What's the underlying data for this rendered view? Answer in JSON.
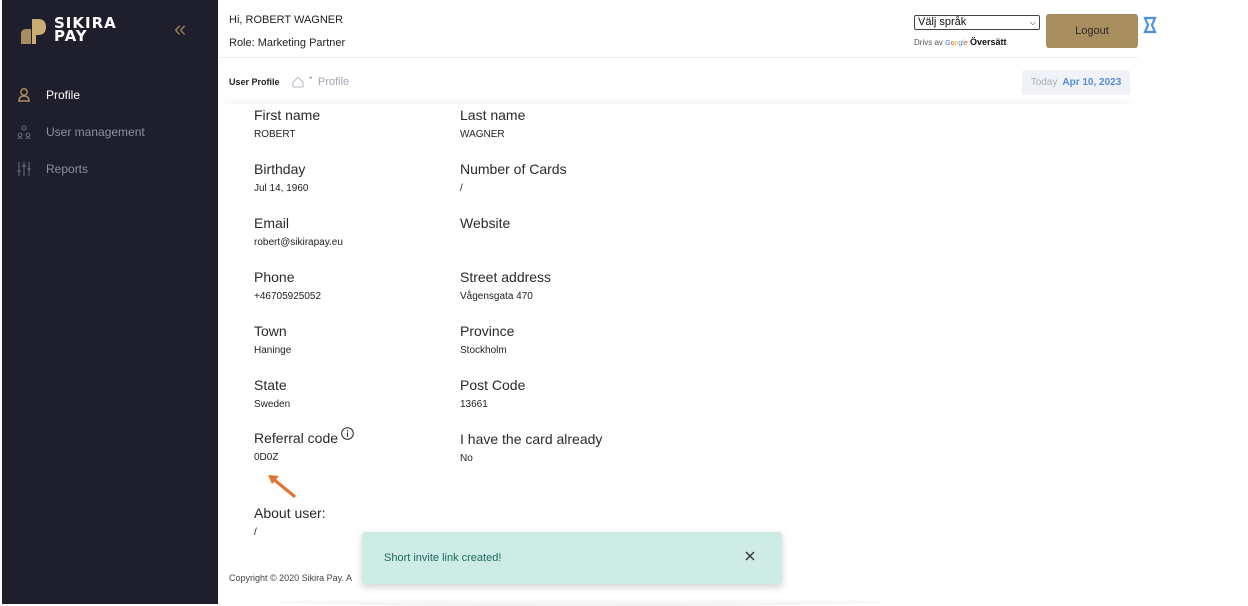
{
  "brand": {
    "line1": "SIKIRA",
    "line2": "PAY",
    "logo_icon": "sikira-pay-logo-icon",
    "accent": "#a88d5e"
  },
  "sidebar": {
    "collapse_icon": "double-chevron-left-icon",
    "items": [
      {
        "label": "Profile",
        "icon": "person-icon",
        "active": true
      },
      {
        "label": "User management",
        "icon": "users-icon",
        "active": false
      },
      {
        "label": "Reports",
        "icon": "sliders-icon",
        "active": false
      }
    ]
  },
  "header": {
    "greeting": "Hi, ROBERT WAGNER",
    "role": "Role: Marketing Partner",
    "language_select": "Välj språk",
    "powered_prefix": "Drivs av",
    "powered_google": "Google",
    "powered_suffix": "Översätt",
    "logout_label": "Logout"
  },
  "subheader": {
    "title": "User Profile",
    "breadcrumb": "Profile",
    "date_label": "Today",
    "date_value": "Apr 10, 2023"
  },
  "profile": {
    "first_name": {
      "label": "First name",
      "value": "ROBERT"
    },
    "last_name": {
      "label": "Last name",
      "value": "WAGNER"
    },
    "birthday": {
      "label": "Birthday",
      "value": "Jul 14, 1960"
    },
    "cards": {
      "label": "Number of Cards",
      "value": "/"
    },
    "email": {
      "label": "Email",
      "value": "robert@sikirapay.eu"
    },
    "website": {
      "label": "Website",
      "value": ""
    },
    "phone": {
      "label": "Phone",
      "value": "+46705925052"
    },
    "street": {
      "label": "Street address",
      "value": "Vågensgata 470"
    },
    "town": {
      "label": "Town",
      "value": "Haninge"
    },
    "province": {
      "label": "Province",
      "value": "Stockholm"
    },
    "state": {
      "label": "State",
      "value": "Sweden"
    },
    "post_code": {
      "label": "Post Code",
      "value": "13661"
    },
    "referral": {
      "label": "Referral code",
      "value": "0D0Z"
    },
    "has_card": {
      "label": "I have the card already",
      "value": "No"
    },
    "about": {
      "label": "About user:",
      "value": "/"
    }
  },
  "footer": {
    "copyright": "Copyright © 2020 Sikira Pay. A"
  },
  "toast": {
    "message": "Short invite link created!"
  }
}
